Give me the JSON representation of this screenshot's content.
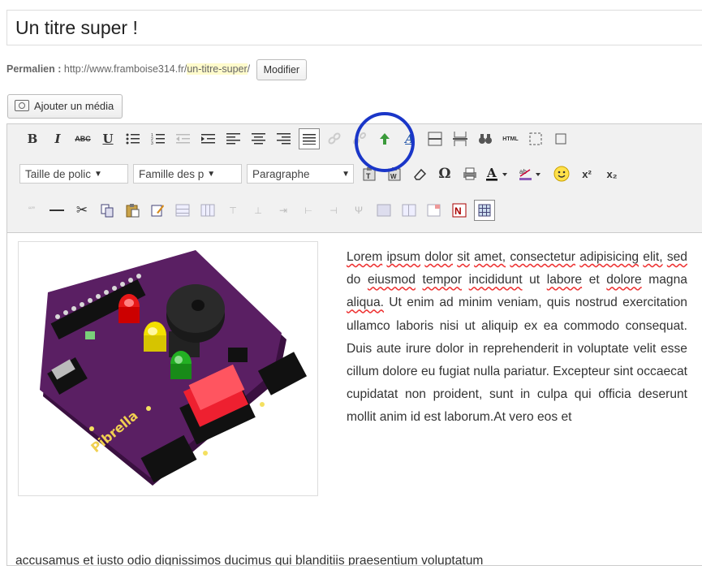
{
  "post": {
    "title": "Un titre super !",
    "permalink_label": "Permalien :",
    "permalink_base": "http://www.framboise314.fr/",
    "permalink_slug": "un-titre-super",
    "permalink_suffix": "/",
    "modify_label": "Modifier",
    "add_media_label": "Ajouter un média"
  },
  "toolbar": {
    "font_size_label": "Taille de polic",
    "font_family_label": "Famille des p",
    "format_label": "Paragraphe",
    "html_label": "HTML",
    "row1_icons": [
      "bold-icon",
      "italic-icon",
      "strikethrough-icon",
      "underline-icon",
      "bullet-list-icon",
      "numbered-list-icon",
      "outdent-icon",
      "indent-icon",
      "align-left-icon",
      "align-center-icon",
      "align-right-icon",
      "align-justify-icon",
      "insert-link-icon",
      "unlink-icon",
      "insert-image-icon",
      "spellcheck-icon",
      "horizontal-rule-icon",
      "page-break-icon",
      "find-replace-icon",
      "html-icon",
      "fullscreen-icon",
      "more-icon"
    ]
  },
  "content": {
    "paragraph_words": [
      "Lorem",
      "ipsum",
      "dolor",
      "sit",
      "amet,",
      "consectetur",
      "adipisicing",
      "elit,",
      "sed",
      "do",
      "eiusmod",
      "tempor",
      "incididunt",
      "ut",
      "labore",
      "et",
      "dolore",
      "magna",
      "aliqua.",
      "Ut",
      "enim",
      "ad",
      "minim",
      "veniam,",
      "quis",
      "nostrud",
      "exercitation",
      "ullamco",
      "laboris",
      "nisi",
      "ut",
      "aliquip",
      "ex",
      "ea",
      "commodo",
      "consequat.",
      "Duis",
      "aute",
      "irure",
      "dolor",
      "in",
      "reprehenderit",
      "in",
      "voluptate",
      "velit",
      "esse",
      "cillum",
      "dolore",
      "eu",
      "fugiat",
      "nulla",
      "pariatur.",
      "Excepteur",
      "sint",
      "occaecat",
      "cupidatat",
      "non",
      "proident,",
      "sunt",
      "in",
      "culpa",
      "qui",
      "officia",
      "deserunt",
      "mollit",
      "anim",
      "id",
      "est",
      "laborum.At",
      "vero",
      "eos",
      "et"
    ],
    "tail_line": "accusamus et iusto odio dignissimos ducimus qui blanditiis praesentium voluptatum",
    "board_label": "Pibrella"
  },
  "colors": {
    "highlight_circle": "#1a36c8",
    "board_purple": "#5a1f63",
    "slug_highlight": "#fffbcc"
  }
}
